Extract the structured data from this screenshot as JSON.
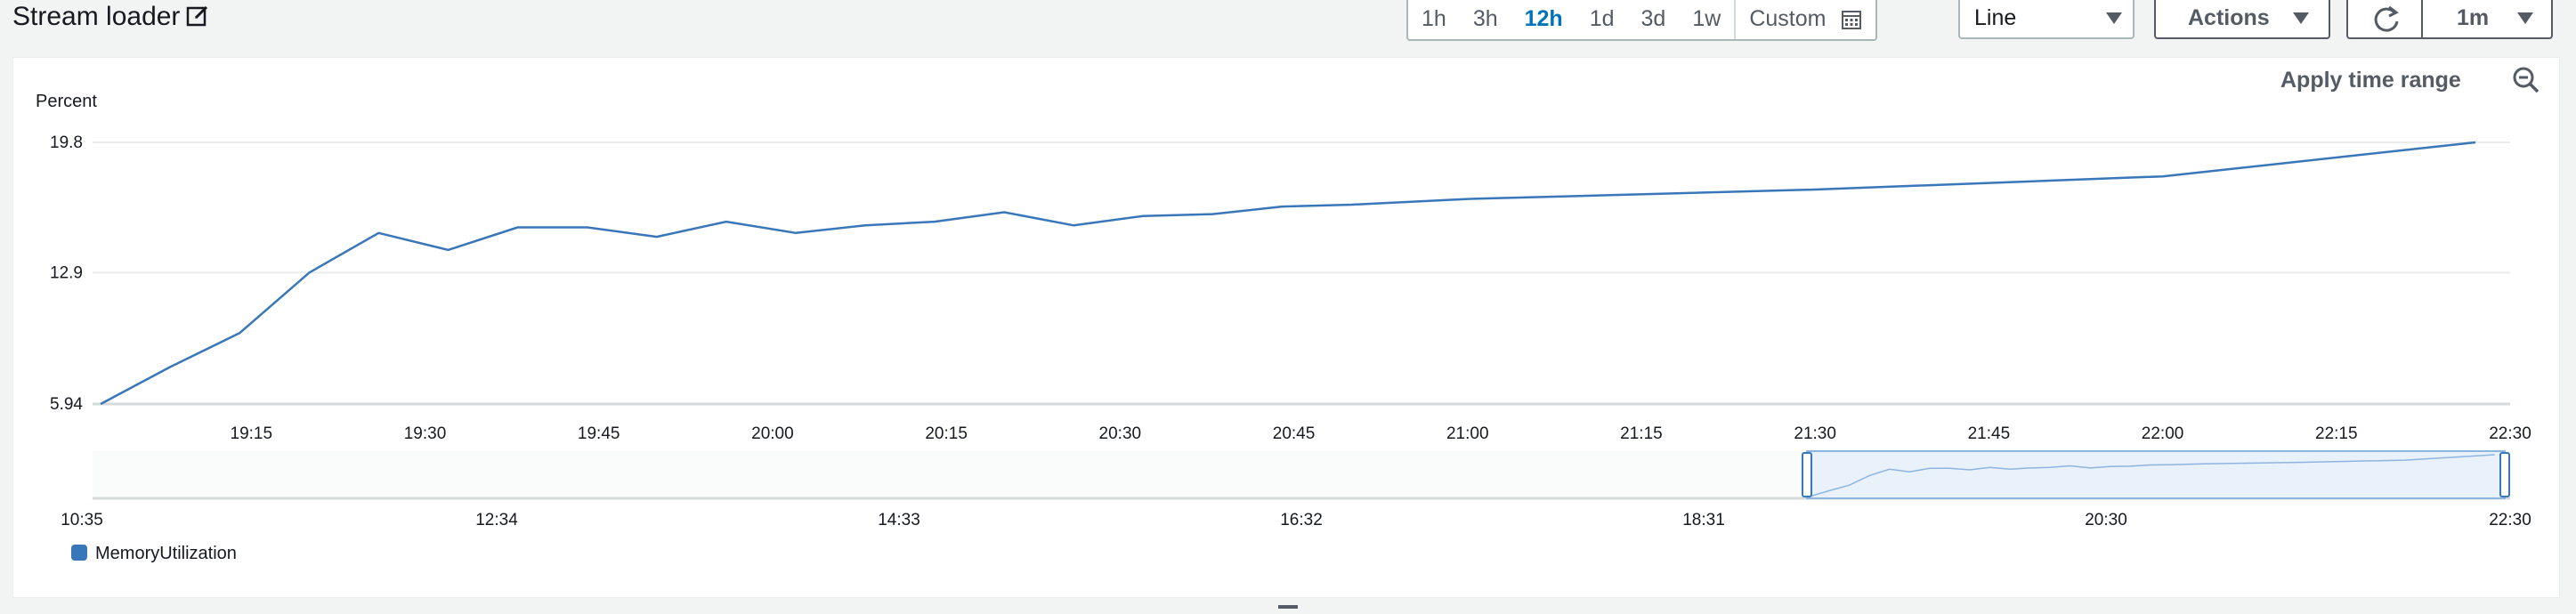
{
  "header": {
    "title": "Stream loader",
    "time_ranges": [
      "1h",
      "3h",
      "12h",
      "1d",
      "3d",
      "1w"
    ],
    "active_time_range": "12h",
    "custom_label": "Custom",
    "chart_type_select": "Line",
    "actions_label": "Actions",
    "refresh_interval": "1m"
  },
  "panel": {
    "apply_time_range_label": "Apply time range"
  },
  "colors": {
    "series": "#3a77b9",
    "active": "#0073bb",
    "grid": "#e9ebed",
    "navigator_selection": "#e9f1fb"
  },
  "chart_data": {
    "type": "line",
    "ylabel": "Percent",
    "yticks": [
      5.94,
      12.9,
      19.8
    ],
    "ylim": [
      5.94,
      19.8
    ],
    "x": [
      "19:02",
      "19:08",
      "19:14",
      "19:20",
      "19:26",
      "19:32",
      "19:38",
      "19:44",
      "19:50",
      "19:56",
      "20:02",
      "20:08",
      "20:14",
      "20:20",
      "20:26",
      "20:32",
      "20:38",
      "20:44",
      "20:50",
      "21:00",
      "21:30",
      "22:00",
      "22:27"
    ],
    "x_minutes": [
      1142,
      1148,
      1154,
      1160,
      1166,
      1172,
      1178,
      1184,
      1190,
      1196,
      1202,
      1208,
      1214,
      1220,
      1226,
      1232,
      1238,
      1244,
      1250,
      1260,
      1290,
      1320,
      1347
    ],
    "series": [
      {
        "name": "MemoryUtilization",
        "color": "#3a77b9",
        "values": [
          5.94,
          7.9,
          9.7,
          12.9,
          15.0,
          14.1,
          15.3,
          15.3,
          14.8,
          15.6,
          15.0,
          15.4,
          15.6,
          16.1,
          15.4,
          15.9,
          16.0,
          16.4,
          16.5,
          16.8,
          17.3,
          18.0,
          19.8
        ]
      }
    ],
    "xticks": [
      "19:15",
      "19:30",
      "19:45",
      "20:00",
      "20:15",
      "20:30",
      "20:45",
      "21:00",
      "21:15",
      "21:30",
      "21:45",
      "22:00",
      "22:15",
      "22:30"
    ],
    "xtick_minutes": [
      1155,
      1170,
      1185,
      1200,
      1215,
      1230,
      1245,
      1260,
      1275,
      1290,
      1305,
      1320,
      1335,
      1350
    ],
    "xlim_minutes": [
      1141.3,
      1350
    ],
    "navigator": {
      "xticks": [
        "10:35",
        "12:34",
        "14:33",
        "16:32",
        "18:31",
        "20:30",
        "22:30"
      ],
      "selected_range": [
        "19:01",
        "22:30"
      ]
    },
    "legend": [
      "MemoryUtilization"
    ],
    "legend_position": "bottom-left",
    "grid": true
  }
}
